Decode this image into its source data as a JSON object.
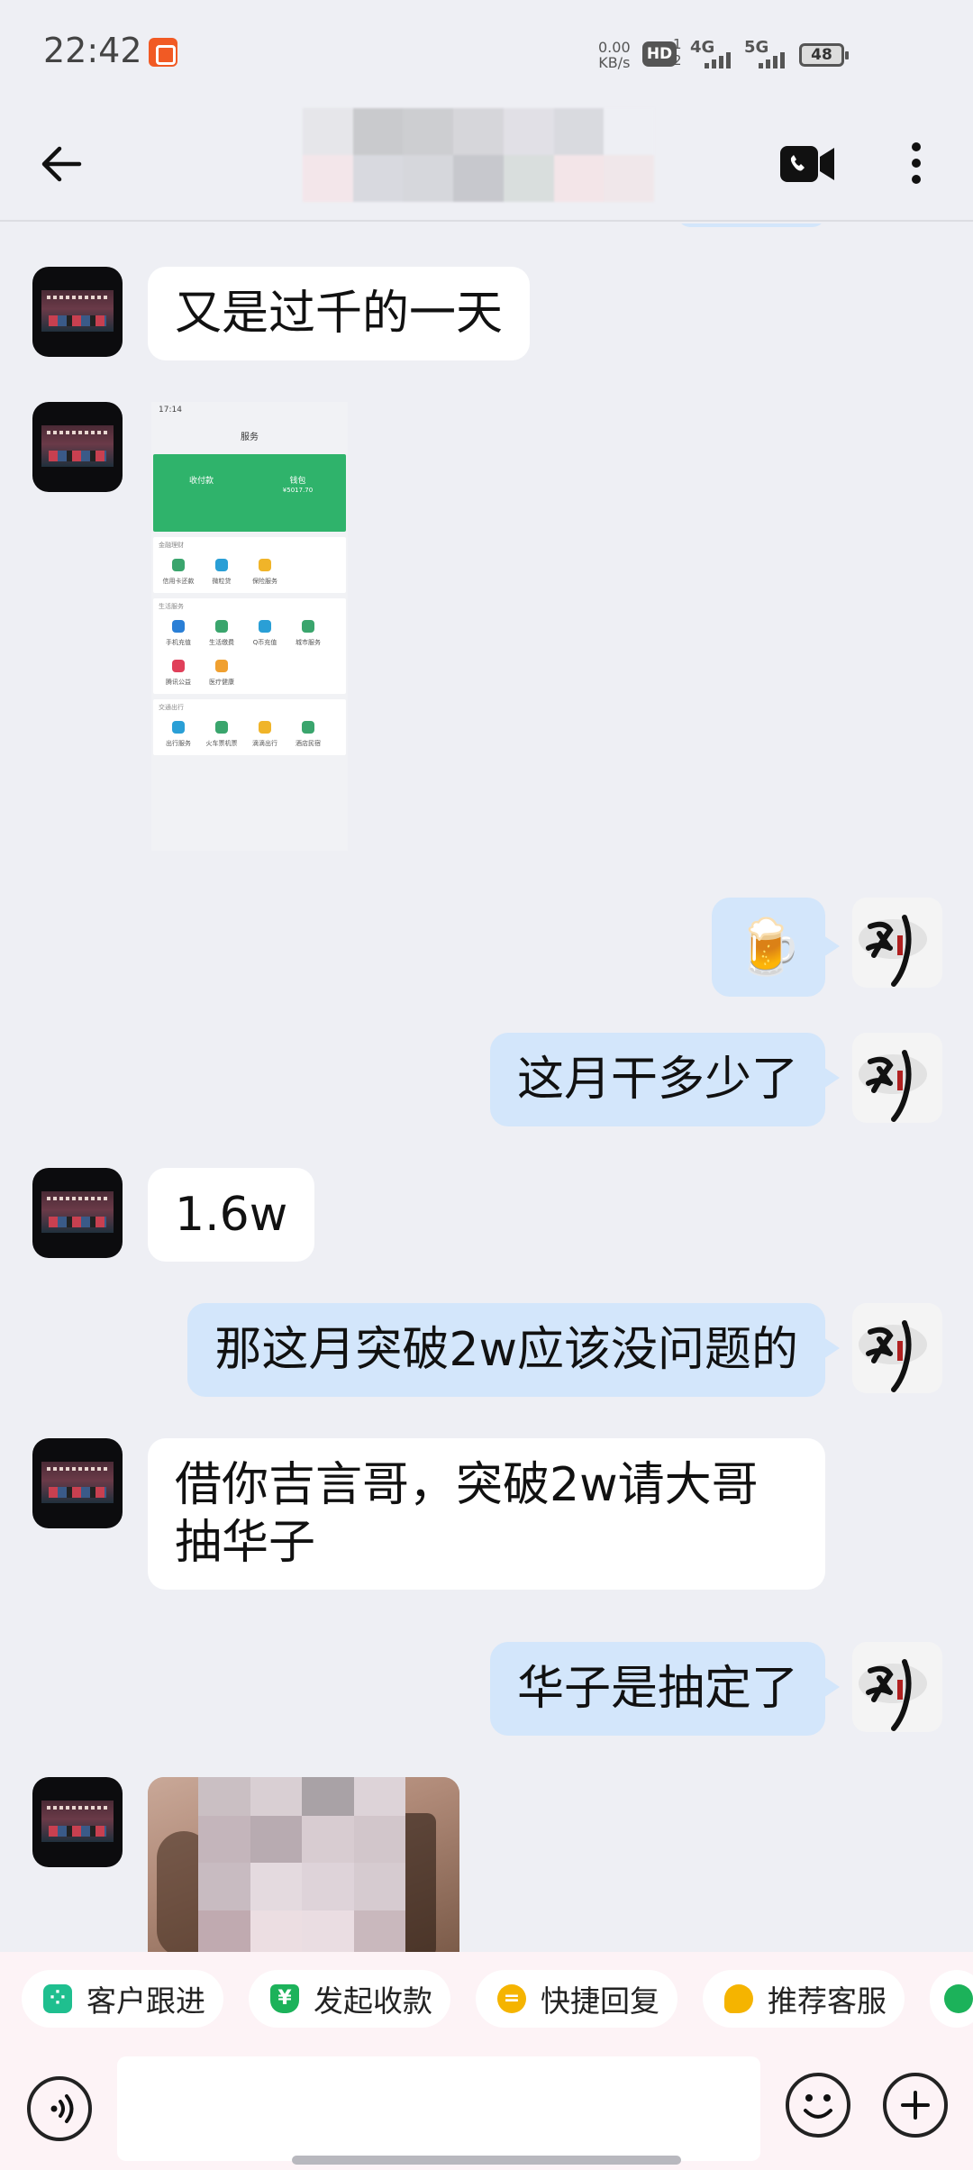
{
  "status_bar": {
    "time": "22:42",
    "net_speed_value": "0.00",
    "net_speed_unit": "KB/s",
    "hd_label": "HD",
    "sim_top": "1",
    "sim_bottom": "2",
    "signal_1_label": "4G",
    "signal_2_label": "5G",
    "battery": "48"
  },
  "header": {
    "back_icon": "arrow-left-icon",
    "title_blurred": true,
    "video_icon": "video-call-icon",
    "more_icon": "more-vertical-icon"
  },
  "messages": [
    {
      "side": "in",
      "type": "text",
      "text": "又是过千的一天"
    },
    {
      "side": "in",
      "type": "image",
      "preview": {
        "time": "17:14",
        "title": "服务",
        "green_left": "收付款",
        "green_right": "钱包",
        "wallet_balance": "¥5017.70",
        "section_1": "金融理财",
        "section_1_items": [
          "信用卡还款",
          "微粒贷",
          "保险服务"
        ],
        "section_2": "生活服务",
        "section_2_items": [
          "手机充值",
          "生活缴费",
          "Q币充值",
          "城市服务",
          "腾讯公益",
          "医疗健康"
        ],
        "section_3": "交通出行",
        "section_3_items": [
          "出行服务",
          "火车票机票",
          "滴滴出行",
          "酒店民宿"
        ]
      }
    },
    {
      "side": "out",
      "type": "emoji",
      "text": "🍺"
    },
    {
      "side": "out",
      "type": "text",
      "text": "这月干多少了"
    },
    {
      "side": "in",
      "type": "text",
      "text": "1.6w"
    },
    {
      "side": "out",
      "type": "text",
      "text": "那这月突破2w应该没问题的"
    },
    {
      "side": "in",
      "type": "text",
      "text": "借你吉言哥，突破2w请大哥抽华子"
    },
    {
      "side": "out",
      "type": "text",
      "text": "华子是抽定了"
    },
    {
      "side": "in",
      "type": "photo",
      "blurred": true
    }
  ],
  "quick_actions": [
    {
      "label": "客户跟进",
      "icon": "customer-follow-icon",
      "color": "#1fbf8f"
    },
    {
      "label": "发起收款",
      "icon": "payment-icon",
      "color": "#1cb25a"
    },
    {
      "label": "快捷回复",
      "icon": "quick-reply-icon",
      "color": "#f5b400"
    },
    {
      "label": "推荐客服",
      "icon": "recommend-service-icon",
      "color": "#f5b400"
    },
    {
      "label": "",
      "icon": "contact-icon",
      "color": "#1cb25a"
    }
  ],
  "input": {
    "placeholder": "",
    "voice_icon": "voice-icon",
    "emoji_icon": "emoji-icon",
    "plus_icon": "plus-icon"
  }
}
